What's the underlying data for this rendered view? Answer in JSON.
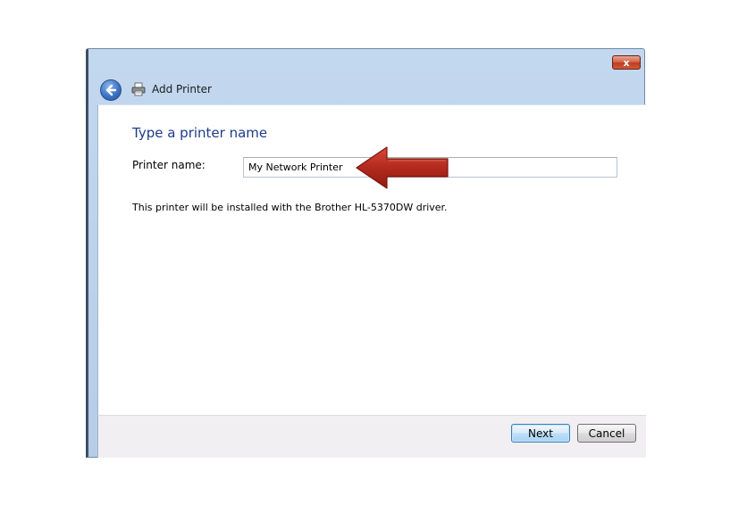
{
  "window": {
    "title": "Add Printer",
    "close_label": "x"
  },
  "content": {
    "heading": "Type a printer name",
    "printer_name_label": "Printer name:",
    "printer_name_value": "My Network Printer",
    "driver_info": "This printer will be installed with the Brother HL-5370DW driver."
  },
  "footer": {
    "next_label": "Next",
    "cancel_label": "Cancel"
  },
  "icons": {
    "back": "back-arrow-icon",
    "printer": "printer-icon",
    "pointer": "red-arrow-annotation"
  },
  "colors": {
    "heading": "#1e3b8a",
    "arrow": "#b22a1e",
    "frame": "#c3d8ef"
  }
}
